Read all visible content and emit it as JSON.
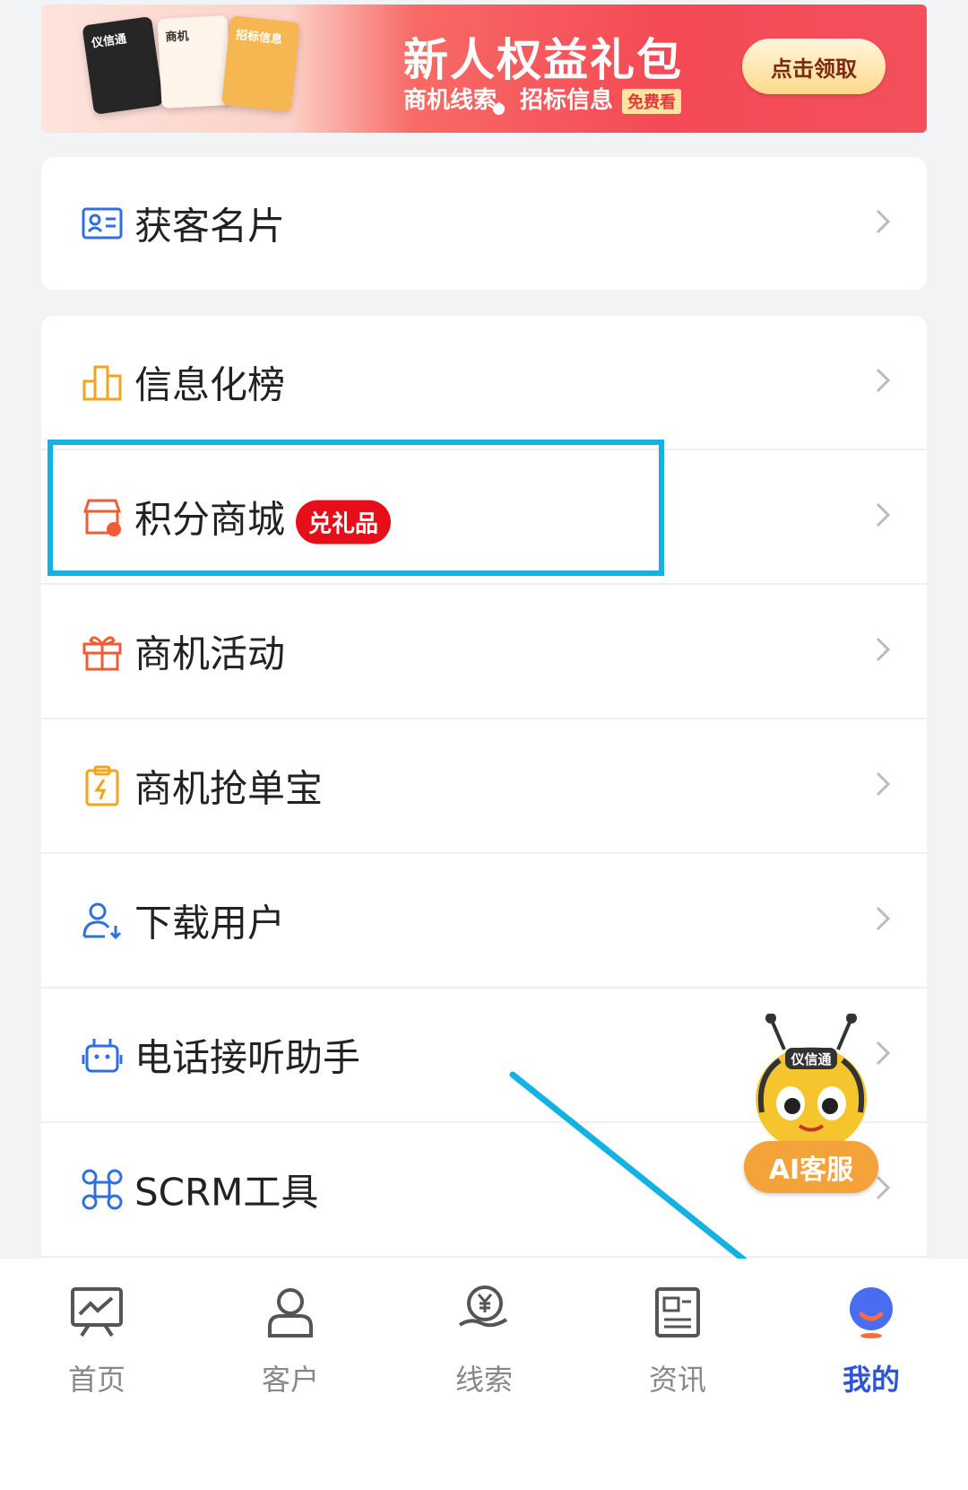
{
  "banner": {
    "title": "新人权益礼包",
    "subtitle": "商机线索、招标信息",
    "tag": "免费看",
    "button": "点击领取",
    "cards": [
      "仪信通",
      "商机",
      "招标信息"
    ]
  },
  "menu": {
    "card1": [
      {
        "label": "获客名片"
      }
    ],
    "card2": [
      {
        "label": "信息化榜"
      },
      {
        "label": "积分商城",
        "badge": "兑礼品"
      },
      {
        "label": "商机活动"
      },
      {
        "label": "商机抢单宝"
      },
      {
        "label": "下载用户"
      },
      {
        "label": "电话接听助手"
      },
      {
        "label": "SCRM工具"
      }
    ]
  },
  "assistant": {
    "mascot_text": "仪信通",
    "label": "AI客服"
  },
  "tabs": [
    {
      "label": "首页"
    },
    {
      "label": "客户"
    },
    {
      "label": "线索"
    },
    {
      "label": "资讯"
    },
    {
      "label": "我的"
    }
  ],
  "colors": {
    "accent": "#2f55d4",
    "highlight_box": "#14b1e3",
    "badge": "#e60f19",
    "assistant": "#f4a23a"
  }
}
